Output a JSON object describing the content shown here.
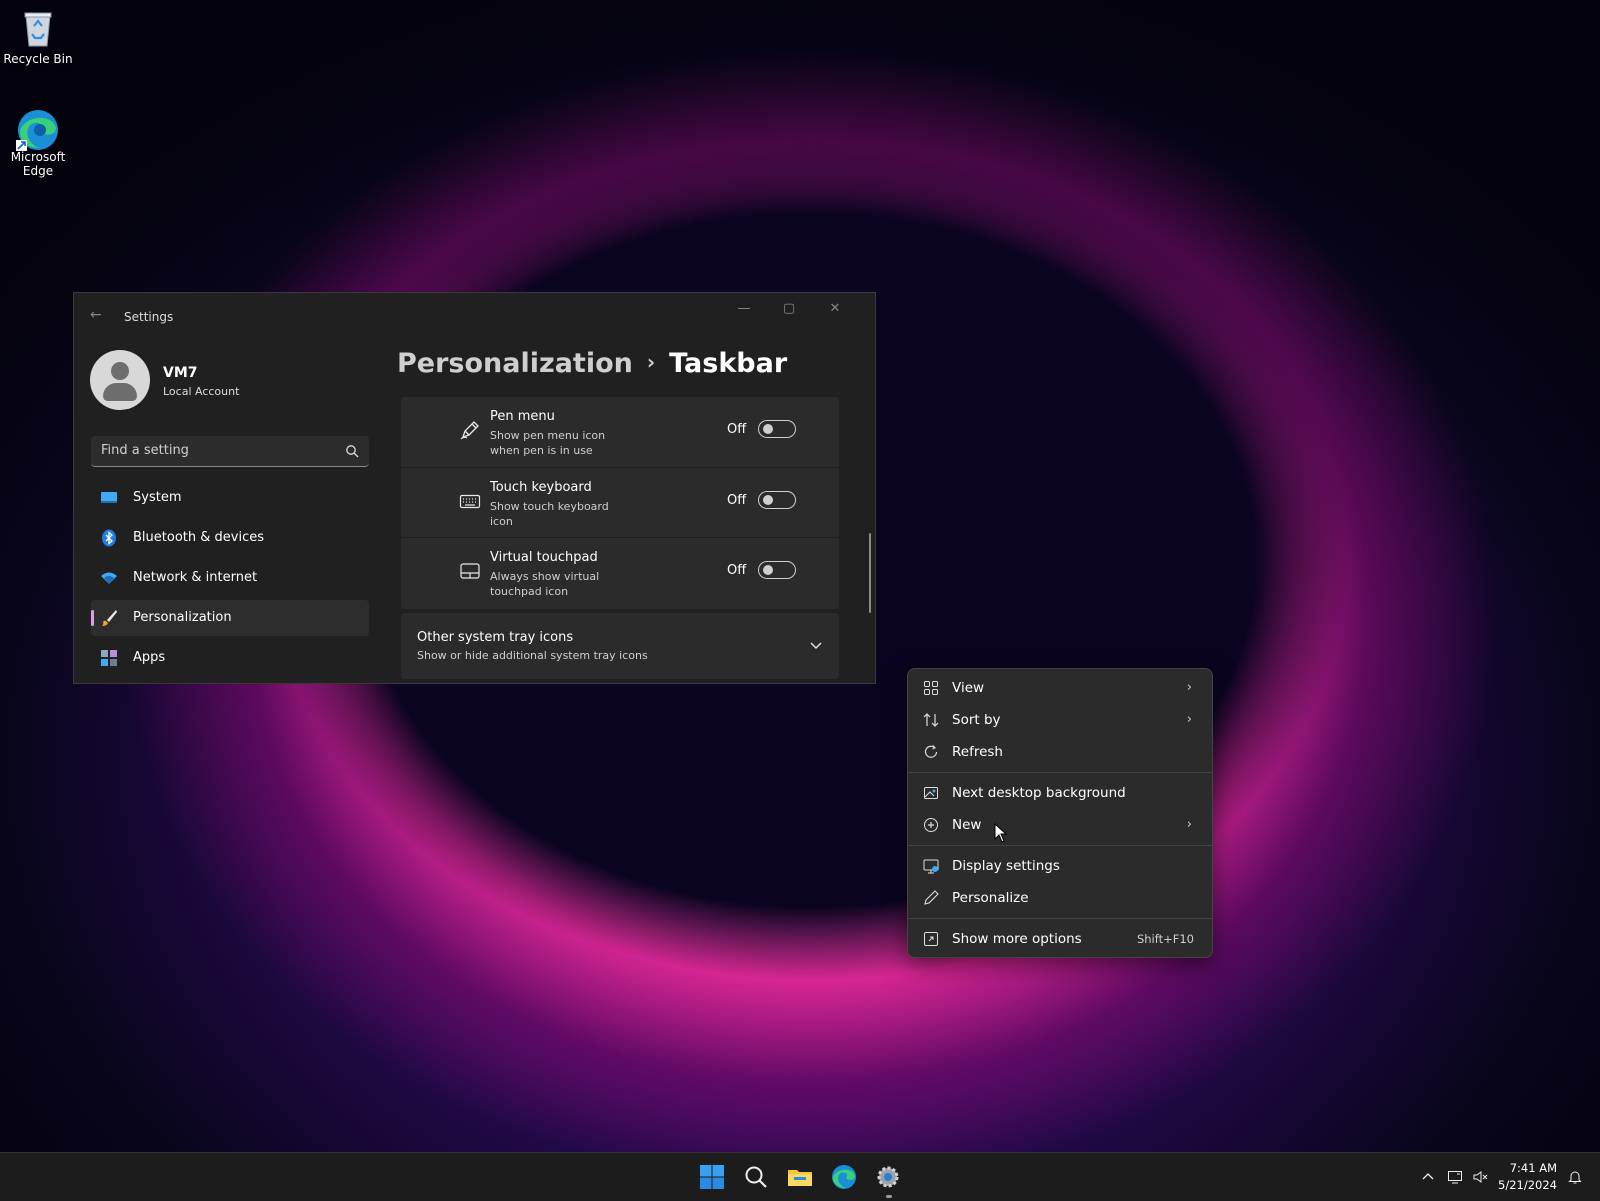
{
  "desktop": {
    "icons": [
      {
        "label": "Recycle Bin",
        "icon": "recycle-bin-icon"
      },
      {
        "label": "Microsoft Edge",
        "icon": "edge-icon"
      }
    ]
  },
  "settings": {
    "title": "Settings",
    "user": {
      "name": "VM7",
      "account": "Local Account"
    },
    "search": {
      "placeholder": "Find a setting"
    },
    "nav": [
      {
        "label": "System",
        "icon": "system-icon"
      },
      {
        "label": "Bluetooth & devices",
        "icon": "bluetooth-icon"
      },
      {
        "label": "Network & internet",
        "icon": "wifi-icon"
      },
      {
        "label": "Personalization",
        "icon": "brush-icon",
        "active": true
      },
      {
        "label": "Apps",
        "icon": "apps-icon"
      }
    ],
    "breadcrumb": {
      "parent": "Personalization",
      "separator": "›",
      "current": "Taskbar"
    },
    "rows": [
      {
        "title": "Pen menu",
        "subtitle": "Show pen menu icon when pen is in use",
        "state": "Off",
        "icon": "pen-icon"
      },
      {
        "title": "Touch keyboard",
        "subtitle": "Show touch keyboard icon",
        "state": "Off",
        "icon": "keyboard-icon"
      },
      {
        "title": "Virtual touchpad",
        "subtitle": "Always show virtual touchpad icon",
        "state": "Off",
        "icon": "touchpad-icon"
      }
    ],
    "expander": {
      "title": "Other system tray icons",
      "subtitle": "Show or hide additional system tray icons"
    }
  },
  "context_menu": {
    "items": [
      {
        "label": "View",
        "icon": "view-grid-icon",
        "submenu": true
      },
      {
        "label": "Sort by",
        "icon": "sort-icon",
        "submenu": true
      },
      {
        "label": "Refresh",
        "icon": "refresh-icon"
      },
      {
        "label": "Next desktop background",
        "icon": "next-background-icon"
      },
      {
        "label": "New",
        "icon": "new-plus-icon",
        "submenu": true
      },
      {
        "label": "Display settings",
        "icon": "display-icon"
      },
      {
        "label": "Personalize",
        "icon": "pen-brush-icon"
      },
      {
        "label": "Show more options",
        "icon": "more-options-icon",
        "shortcut": "Shift+F10"
      }
    ],
    "arrow": "›"
  },
  "taskbar": {
    "time": "7:41 AM",
    "date": "5/21/2024"
  },
  "colors": {
    "accent": "#d9a0e8",
    "settings_bg": "#202020",
    "card_bg": "#2b2b2b",
    "taskbar_bg": "#1c1c1c"
  }
}
